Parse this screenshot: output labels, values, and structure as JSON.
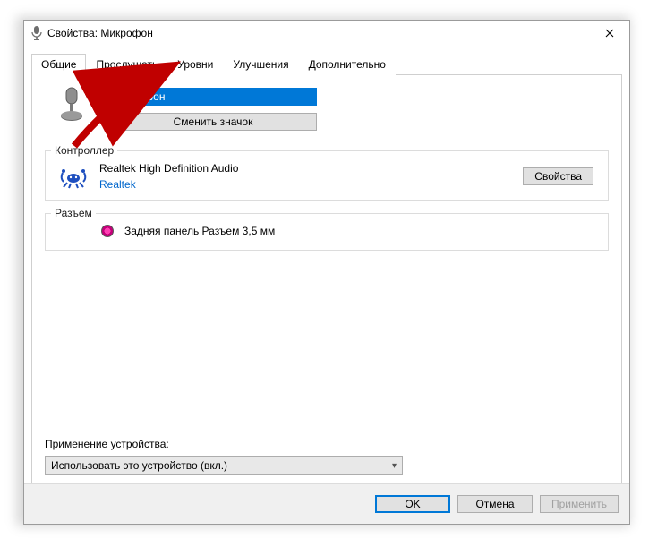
{
  "window": {
    "title": "Свойства: Микрофон"
  },
  "tabs": {
    "general": "Общие",
    "listen": "Прослушать",
    "levels": "Уровни",
    "enhance": "Улучшения",
    "advanced": "Дополнительно"
  },
  "device": {
    "name": "Микрофон",
    "change_icon": "Сменить значок"
  },
  "controller": {
    "legend": "Контроллер",
    "name": "Realtek High Definition Audio",
    "vendor": "Realtek",
    "props": "Свойства"
  },
  "jack": {
    "legend": "Разъем",
    "text": "Задняя панель Разъем 3,5 мм"
  },
  "usage": {
    "label": "Применение устройства:",
    "value": "Использовать это устройство (вкл.)"
  },
  "buttons": {
    "ok": "OK",
    "cancel": "Отмена",
    "apply": "Применить"
  }
}
